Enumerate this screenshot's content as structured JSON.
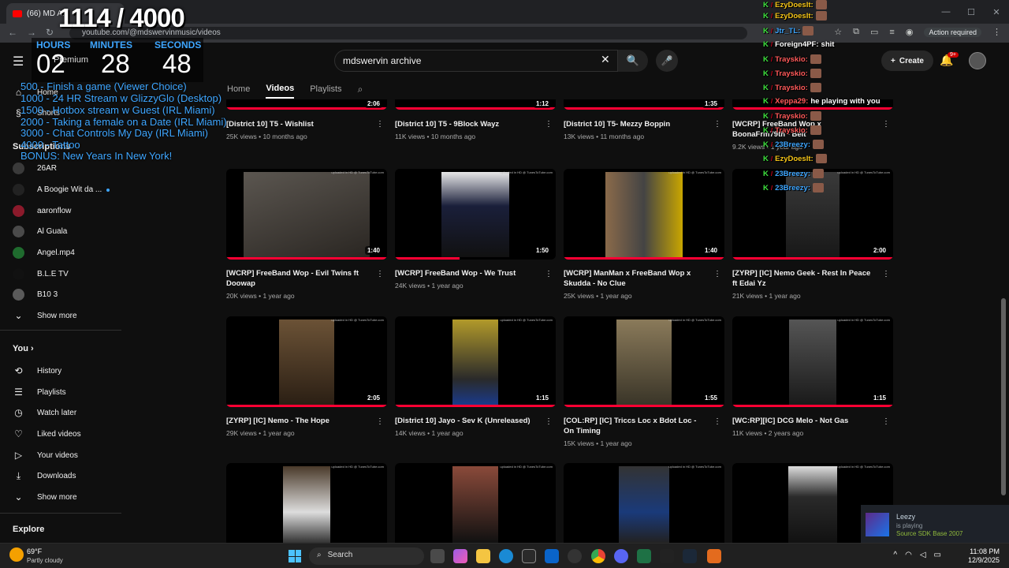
{
  "browser": {
    "tab_title": "(66) MD Arc",
    "url": "youtube.com/@mdswervinmusic/videos",
    "action_required": "Action required"
  },
  "header": {
    "search_value": "mdswervin archive",
    "create_label": "Create",
    "notif_count": "9+"
  },
  "overlay": {
    "counter": "1114 / 4000",
    "timer": [
      {
        "label": "HOURS",
        "value": "02"
      },
      {
        "label": "MINUTES",
        "value": "28"
      },
      {
        "label": "SECONDS",
        "value": "48"
      }
    ],
    "premium_label": "Premium",
    "goals": [
      "500 - Finish a game (Viewer Choice)",
      "1000 - 24 HR Stream w GlizzyGlo (Desktop)",
      "1500 - Hotbox stream w Guest (IRL Miami)",
      "2000 - Taking a female on a Date (IRL Miami)",
      "3000 - Chat Controls My Day (IRL Miami)",
      "4000 - Tattoo",
      "BONUS: New Years In New York!"
    ]
  },
  "sidebar": {
    "home": "Home",
    "shorts": "Shorts",
    "subscriptions_heading": "Subscriptions",
    "subscriptions": [
      {
        "name": "26AR",
        "color": "#3a3a3a"
      },
      {
        "name": "A Boogie Wit da ...",
        "color": "#222222"
      },
      {
        "name": "aaronflow",
        "color": "#8b1a2b"
      },
      {
        "name": "Al Guala",
        "color": "#4a4a4a"
      },
      {
        "name": "Angel.mp4",
        "color": "#1f6b2e"
      },
      {
        "name": "B.L.E TV",
        "color": "#111111"
      },
      {
        "name": "B10 3",
        "color": "#5a5a5a"
      }
    ],
    "show_more": "Show more",
    "you_heading": "You",
    "you_items": [
      {
        "label": "History",
        "icon": "history-icon",
        "glyph": "⟲"
      },
      {
        "label": "Playlists",
        "icon": "playlists-icon",
        "glyph": "☰"
      },
      {
        "label": "Watch later",
        "icon": "watch-later-icon",
        "glyph": "◷"
      },
      {
        "label": "Liked videos",
        "icon": "thumbs-up-icon",
        "glyph": "👍"
      },
      {
        "label": "Your videos",
        "icon": "your-videos-icon",
        "glyph": "▶"
      },
      {
        "label": "Downloads",
        "icon": "download-icon",
        "glyph": "⤓"
      }
    ],
    "show_more_2": "Show more",
    "explore_heading": "Explore"
  },
  "channel_tabs": [
    "Home",
    "Videos",
    "Playlists"
  ],
  "videos_row1": [
    {
      "title": "[District 10] T5 - Wishlist",
      "meta": "25K views • 10 months ago",
      "duration": "2:06"
    },
    {
      "title": "[District 10] T5 - 9Block Wayz",
      "meta": "11K views • 10 months ago",
      "duration": "1:12"
    },
    {
      "title": "[District 10] T5- Mezzy Boppin",
      "meta": "13K views • 11 months ago",
      "duration": "1:35"
    },
    {
      "title": "[WCRP] FreeBand Wop x BoonaFrm79th - Belt",
      "meta": "9.2K views • 1 year ago",
      "duration": ""
    }
  ],
  "videos_row2": [
    {
      "title": "[WCRP] FreeBand Wop - Evil Twins ft Doowap",
      "meta": "20K views • 1 year ago",
      "duration": "1:40"
    },
    {
      "title": "[WCRP] FreeBand Wop - We Trust",
      "meta": "24K views • 1 year ago",
      "duration": "1:50"
    },
    {
      "title": "[WCRP] ManMan x FreeBand Wop x Skudda - No Clue",
      "meta": "25K views • 1 year ago",
      "duration": "1:40"
    },
    {
      "title": "[ZYRP] [IC] Nemo Geek - Rest In Peace ft Edai Yz",
      "meta": "21K views • 1 year ago",
      "duration": "2:00"
    }
  ],
  "videos_row3": [
    {
      "title": "[ZYRP] [IC] Nemo - The Hope",
      "meta": "29K views • 1 year ago",
      "duration": "2:05"
    },
    {
      "title": "[District 10] Jayo - Sev K (Unreleased)",
      "meta": "14K views • 1 year ago",
      "duration": "1:15"
    },
    {
      "title": "[COL:RP] [IC] Triccs Loc x Bdot Loc - On Timing",
      "meta": "15K views • 1 year ago",
      "duration": "1:55"
    },
    {
      "title": "[WC:RP][IC] DCG Melo - Not Gas",
      "meta": "11K views • 2 years ago",
      "duration": "1:15"
    }
  ],
  "watermark": "uploaded in HD @ TunesToTube.com",
  "chat": [
    {
      "user": "EzyDoesIt:",
      "msg": "",
      "color": "#f5c518"
    },
    {
      "user": "EzyDoesIt:",
      "msg": "",
      "color": "#f5c518"
    },
    {
      "user": "Jtr_TL:",
      "msg": "",
      "color": "#3ea6ff"
    },
    {
      "user": "Foreign4PF:",
      "msg": "shit",
      "color": "#ffffff"
    },
    {
      "user": "Trayskio:",
      "msg": "",
      "color": "#ff5a5a"
    },
    {
      "user": "Trayskio:",
      "msg": "",
      "color": "#ff5a5a"
    },
    {
      "user": "Trayskio:",
      "msg": "",
      "color": "#ff5a5a"
    },
    {
      "user": "Xeppa29:",
      "msg": "he playing with you",
      "color": "#ff5a5a"
    },
    {
      "user": "Trayskio:",
      "msg": "",
      "color": "#ff5a5a"
    },
    {
      "user": "Trayskio:",
      "msg": "",
      "color": "#ff5a5a"
    },
    {
      "user": "23Breezy:",
      "msg": "",
      "color": "#3ea6ff"
    },
    {
      "user": "EzyDoesIt:",
      "msg": "",
      "color": "#f5c518"
    },
    {
      "user": "23Breezy:",
      "msg": "",
      "color": "#3ea6ff"
    },
    {
      "user": "23Breezy:",
      "msg": "",
      "color": "#3ea6ff"
    }
  ],
  "notification": {
    "name": "Leezy",
    "status": "is playing",
    "game": "Source SDK Base 2007"
  },
  "taskbar": {
    "temp": "69°F",
    "weather": "Partly cloudy",
    "search": "Search",
    "time": "11:08 PM",
    "date": "12/9/2025"
  }
}
